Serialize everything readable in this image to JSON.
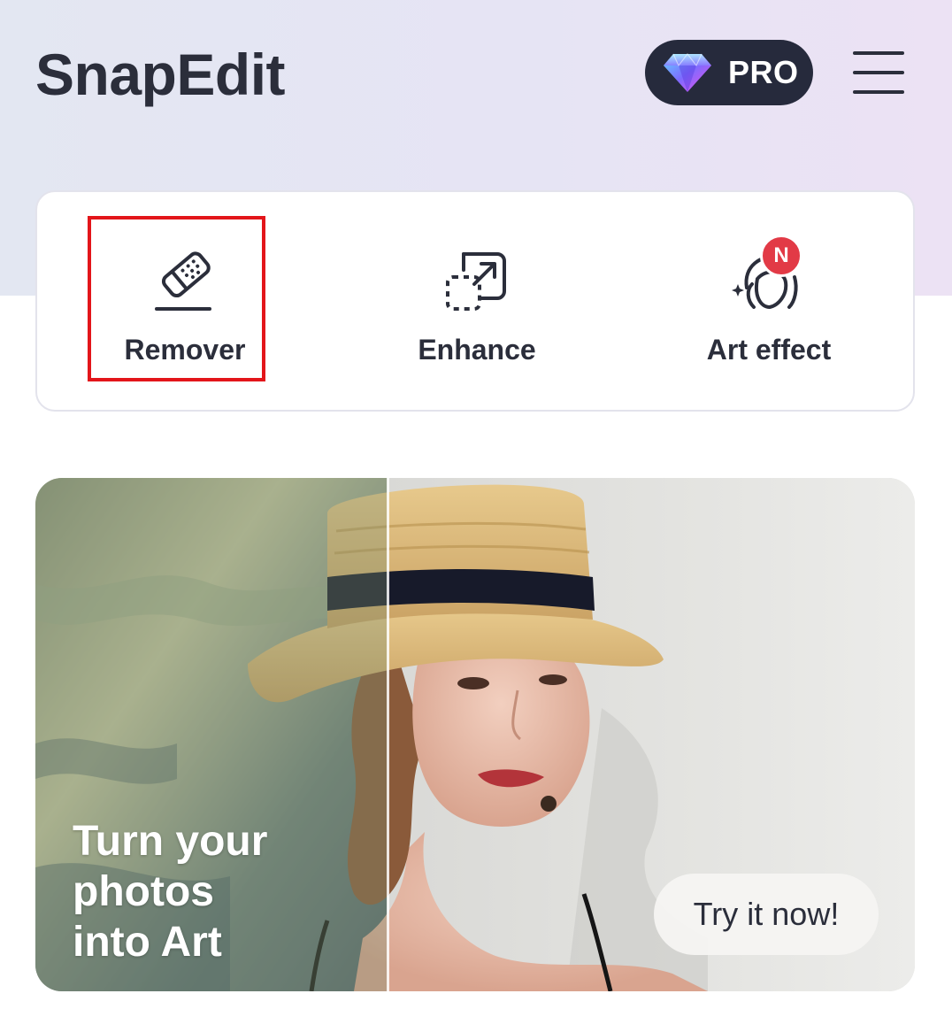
{
  "header": {
    "app_title": "SnapEdit",
    "pro_label": "PRO",
    "pro_icon": "diamond-icon",
    "menu_icon": "hamburger-menu-icon"
  },
  "tools": {
    "items": [
      {
        "label": "Remover",
        "icon": "eraser-icon",
        "highlighted": true
      },
      {
        "label": "Enhance",
        "icon": "enhance-resize-icon"
      },
      {
        "label": "Art effect",
        "icon": "art-face-icon",
        "badge": "N"
      }
    ]
  },
  "banner": {
    "headline_lines": [
      "Turn your",
      "photos",
      "into Art"
    ],
    "cta_label": "Try it now!"
  },
  "colors": {
    "header_gradient_start": "#e3e7f2",
    "header_gradient_end": "#ece2f4",
    "dark": "#262a3c",
    "badge": "#e23a46",
    "highlight_border": "#e3151a"
  }
}
